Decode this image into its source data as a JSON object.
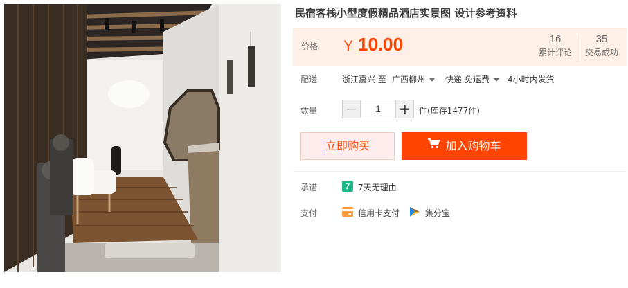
{
  "product": {
    "title": "民宿客栈小型度假精品酒店实景图 设计参考资料"
  },
  "price": {
    "label": "价格",
    "currency": "￥",
    "value": "10.00"
  },
  "stats": {
    "reviews_count": "16",
    "reviews_label": "累计评论",
    "deals_count": "35",
    "deals_label": "交易成功"
  },
  "delivery": {
    "label": "配送",
    "from": "浙江嘉兴 至",
    "to": "广西柳州",
    "method": "快递 免运费",
    "ship_time": "4小时内发货"
  },
  "quantity": {
    "label": "数量",
    "value": "1",
    "minus": "−",
    "plus": "+",
    "stock": "件(库存1477件)"
  },
  "actions": {
    "buy_now": "立即购买",
    "add_to_cart": "加入购物车"
  },
  "promise": {
    "label": "承诺",
    "badge": "7",
    "text": "7天无理由"
  },
  "payment": {
    "label": "支付",
    "methods": [
      {
        "name": "信用卡支付",
        "icon": "credit-card-icon"
      },
      {
        "name": "集分宝",
        "icon": "jifenbao-icon"
      }
    ]
  },
  "colors": {
    "accent": "#ff4400",
    "price_bg": "#fff0e7",
    "promise_badge": "#1fb785"
  }
}
